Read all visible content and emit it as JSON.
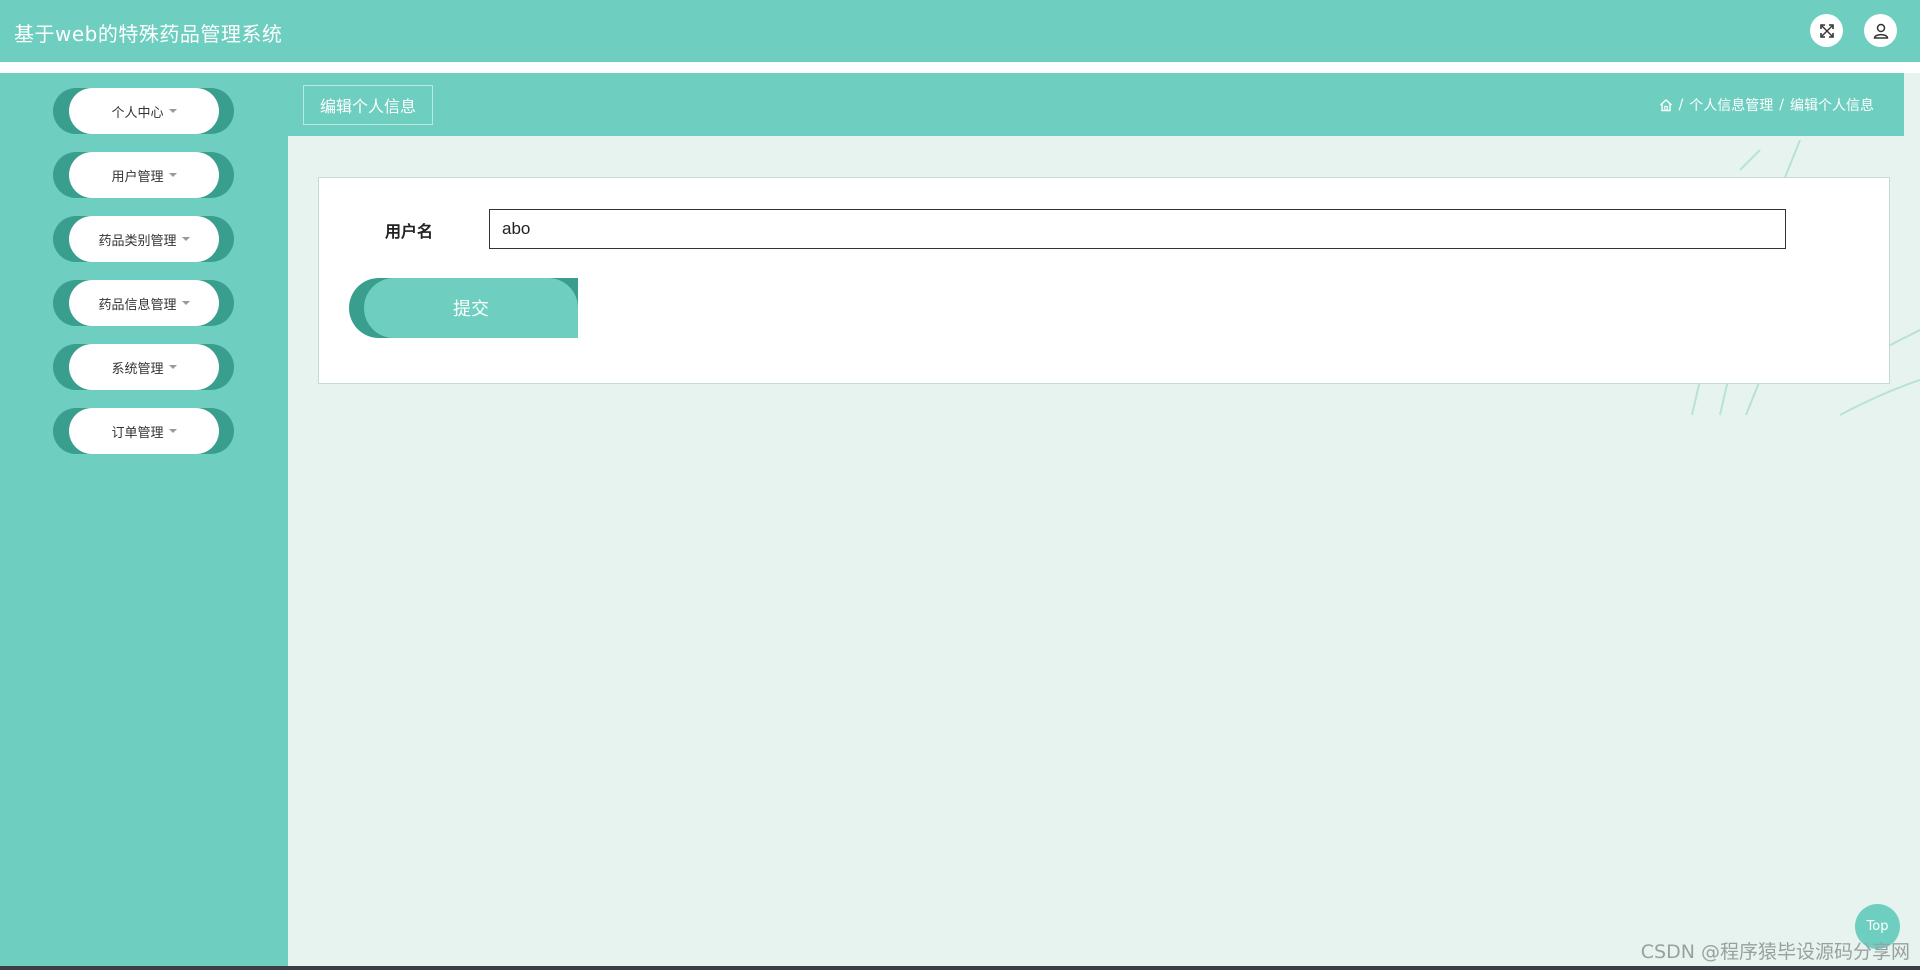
{
  "app": {
    "title": "基于web的特殊药品管理系统"
  },
  "topbar": {
    "icons": [
      "fullscreen-icon",
      "user-icon"
    ]
  },
  "sidebar": {
    "items": [
      {
        "label": "个人中心"
      },
      {
        "label": "用户管理"
      },
      {
        "label": "药品类别管理"
      },
      {
        "label": "药品信息管理"
      },
      {
        "label": "系统管理"
      },
      {
        "label": "订单管理"
      }
    ]
  },
  "header": {
    "page_title": "编辑个人信息",
    "breadcrumb": {
      "sep": "/",
      "level1": "个人信息管理",
      "level2": "编辑个人信息"
    }
  },
  "form": {
    "username_label": "用户名",
    "username_value": "abo",
    "submit_label": "提交"
  },
  "top_button": {
    "label": "Top"
  },
  "watermark": "CSDN @程序猿毕设源码分享网",
  "colors": {
    "primary": "#6ecfc0",
    "primary_dark": "#3a9e8e",
    "background": "#e6f3ee"
  }
}
